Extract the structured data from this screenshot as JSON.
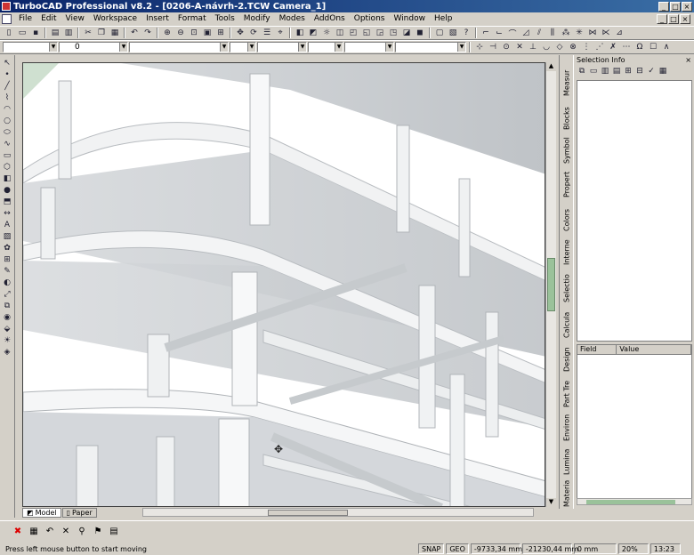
{
  "window": {
    "title": "TurboCAD Professional v8.2 - [0206-A-návrh-2.TCW Camera_1]",
    "controls": [
      "_",
      "□",
      "×"
    ]
  },
  "menu": {
    "items": [
      "File",
      "Edit",
      "View",
      "Workspace",
      "Insert",
      "Format",
      "Tools",
      "Modify",
      "Modes",
      "AddOns",
      "Options",
      "Window",
      "Help"
    ]
  },
  "property_toolbar": {
    "layer_value": "0"
  },
  "tabs": {
    "model": "Model",
    "paper": "Paper"
  },
  "selection_panel": {
    "title": "Selection Info",
    "close": "×",
    "columns": {
      "field": "Field",
      "value": "Value"
    }
  },
  "side_tabs": [
    "Measur",
    "Blocks",
    "Symbol",
    "Propert",
    "Colors",
    "Interne",
    "Selectio",
    "Calcula",
    "Design",
    "Part Tre",
    "Environ",
    "Lumina",
    "Materia"
  ],
  "status": {
    "message": "Press left mouse button to start moving",
    "snap": "SNAP",
    "geo": "GEO",
    "x_coord": "-9733,34 mm",
    "y_coord": "-21230,44 mm",
    "z_coord": "0 mm",
    "zoom": "20%",
    "time": "13:23"
  },
  "colors": {
    "titlebar_start": "#0a246a",
    "titlebar_end": "#3a6ea5",
    "chrome": "#d4d0c8",
    "scroll_thumb": "#9ac29a"
  }
}
